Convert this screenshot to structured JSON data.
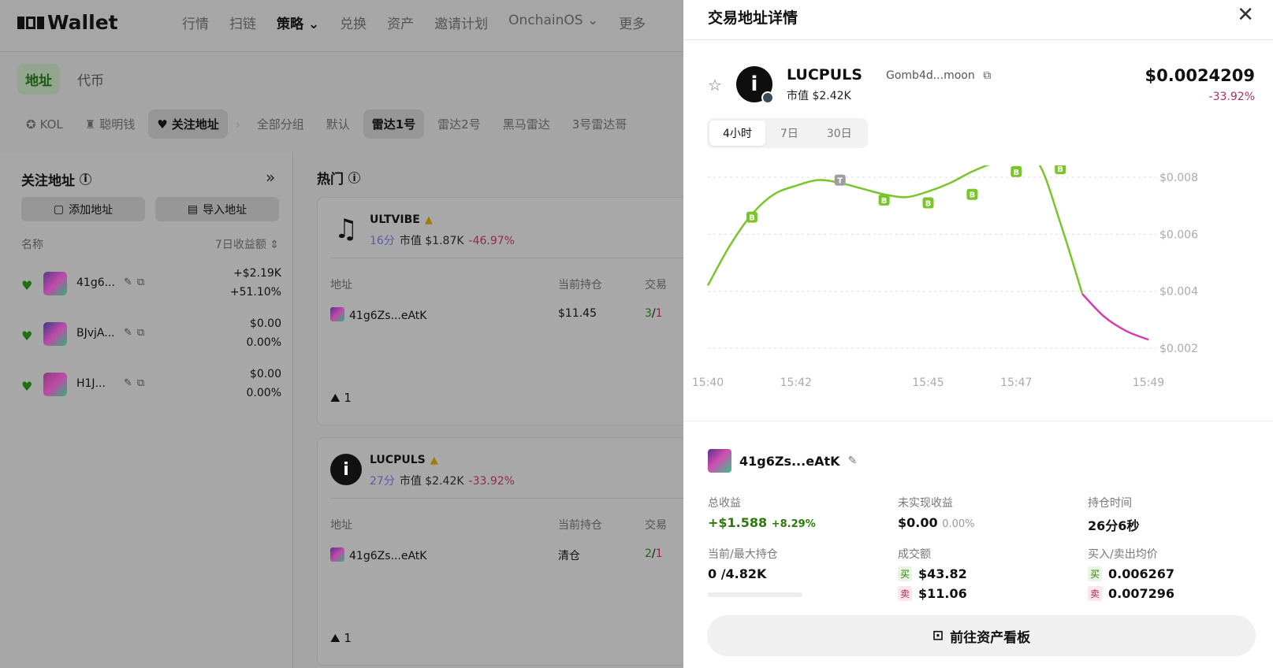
{
  "app": {
    "logo_text": "Wallet"
  },
  "nav": {
    "items": [
      {
        "label": "行情",
        "active": false
      },
      {
        "label": "扫链",
        "active": false
      },
      {
        "label": "策略 ⌄",
        "active": true
      },
      {
        "label": "兑换",
        "active": false
      },
      {
        "label": "资产",
        "active": false
      },
      {
        "label": "邀请计划",
        "active": false
      },
      {
        "label": "OnchainOS ⌄",
        "active": false
      },
      {
        "label": "更多",
        "active": false
      }
    ]
  },
  "subtabs": [
    {
      "label": "地址",
      "active": true
    },
    {
      "label": "代币",
      "active": false
    }
  ],
  "groups": [
    {
      "label": "KOL",
      "icon": "kol-icon",
      "active": false
    },
    {
      "label": "聪明钱",
      "icon": "moneybag-icon",
      "active": false
    },
    {
      "label": "关注地址",
      "icon": "heart-icon",
      "active": true
    },
    {
      "label": "全部分组",
      "active": false
    },
    {
      "label": "默认",
      "active": false
    },
    {
      "label": "雷达1号",
      "active": true
    },
    {
      "label": "雷达2号",
      "active": false
    },
    {
      "label": "黑马雷达",
      "active": false
    },
    {
      "label": "3号雷达哥",
      "active": false
    }
  ],
  "left_panel": {
    "title": "关注地址",
    "add_label": "添加地址",
    "import_label": "导入地址",
    "col_name": "名称",
    "col_profit": "7日收益额 ⇕",
    "rows": [
      {
        "name": "41g6...",
        "value": "+$2.19K",
        "pct": "+51.10%",
        "positive": true,
        "avatar_color": "#5a3a8a"
      },
      {
        "name": "BJvjA...",
        "value": "$0.00",
        "pct": "0.00%",
        "positive": false,
        "avatar_color": "#3a3a8a"
      },
      {
        "name": "H1J...",
        "value": "$0.00",
        "pct": "0.00%",
        "positive": false,
        "avatar_color": "#8a3a7a"
      }
    ]
  },
  "hot": {
    "title": "热门",
    "col_addr": "地址",
    "col_hold": "当前持仓",
    "col_trade": "交易",
    "cards": [
      {
        "token": "ULTVIBE",
        "age": "16分",
        "cap": "市值 $1.87K",
        "chg": "-46.97%",
        "addr": "41g6Zs...eAtK",
        "hold": "$11.45",
        "trades_buy": "3",
        "trades_sell": "1",
        "holders": "1",
        "icon": "music-note-icon"
      },
      {
        "token": "LUCPULS",
        "age": "27分",
        "cap": "市值 $2.42K",
        "chg": "-33.92%",
        "addr": "41g6Zs...eAtK",
        "hold": "清仓",
        "trades_buy": "2",
        "trades_sell": "1",
        "holders": "1",
        "icon": "info-icon"
      }
    ]
  },
  "drawer": {
    "title": "交易地址详情",
    "token_name": "LUCPULS",
    "token_addr": "Gomb4d...moon",
    "market_cap": "市值 $2.42K",
    "price": "$0.0024209",
    "change": "-33.92%",
    "range_tabs": [
      {
        "label": "4小时",
        "active": true
      },
      {
        "label": "7日",
        "active": false
      },
      {
        "label": "30日",
        "active": false
      }
    ],
    "holder_name": "41g6Zs...eAtK",
    "stats": {
      "total_profit_label": "总收益",
      "total_profit": "+$1.588",
      "total_profit_pct": "+8.29%",
      "unrealized_label": "未实现收益",
      "unrealized": "$0.00",
      "unrealized_pct": "0.00%",
      "hold_time_label": "持仓时间",
      "hold_time": "26分6秒",
      "position_label": "当前/最大持仓",
      "position": "0 /4.82K",
      "position_fill": 0,
      "volume_label": "成交额",
      "buy_tag": "买",
      "sell_tag": "卖",
      "volume_buy": "$43.82",
      "volume_sell": "$11.06",
      "avg_label": "买入/卖出均价",
      "avg_buy": "0.006267",
      "avg_sell": "0.007296"
    },
    "dashboard_button": "前往资产看板"
  },
  "chart_data": {
    "type": "line",
    "x_ticks": [
      "15:40",
      "15:42",
      "15:45",
      "15:47",
      "15:49"
    ],
    "y_ticks": [
      "$0.008",
      "$0.006",
      "$0.004",
      "$0.002"
    ],
    "ylim": [
      0.002,
      0.008
    ],
    "series": [
      {
        "color_up": "#7ac52a",
        "color_down": "#d63bb0",
        "x": [
          0,
          0.5,
          1,
          1.5,
          2,
          2.5,
          3,
          3.5,
          4,
          4.5,
          5,
          5.5,
          6,
          6.5,
          7,
          7.5,
          8,
          8.5,
          9,
          9.5,
          10
        ],
        "values": [
          0.0042,
          0.0056,
          0.0067,
          0.0074,
          0.0077,
          0.0079,
          0.0078,
          0.0076,
          0.0074,
          0.0073,
          0.0075,
          0.0078,
          0.0082,
          0.0085,
          0.0086,
          0.0085,
          0.0064,
          0.0039,
          0.0031,
          0.0026,
          0.0023
        ]
      }
    ],
    "markers": [
      {
        "x": 1,
        "y": 0.0066,
        "label": "B",
        "color": "#7ac52a"
      },
      {
        "x": 3,
        "y": 0.0079,
        "label": "T",
        "color": "#9e9e9e"
      },
      {
        "x": 4,
        "y": 0.0072,
        "label": "B",
        "color": "#7ac52a"
      },
      {
        "x": 5,
        "y": 0.0071,
        "label": "B",
        "color": "#7ac52a"
      },
      {
        "x": 6,
        "y": 0.0074,
        "label": "B",
        "color": "#7ac52a"
      },
      {
        "x": 7,
        "y": 0.0082,
        "label": "B",
        "color": "#7ac52a"
      },
      {
        "x": 8,
        "y": 0.0083,
        "label": "B",
        "color": "#7ac52a"
      }
    ]
  }
}
